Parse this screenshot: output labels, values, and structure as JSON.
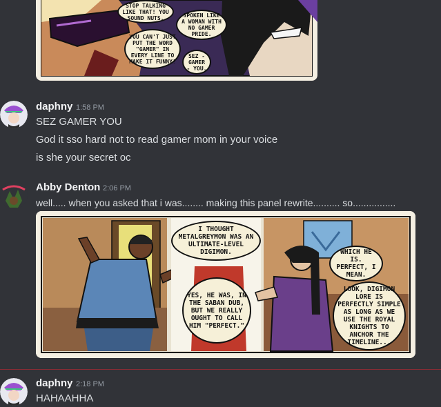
{
  "attachment_top": {
    "bubbles": [
      "STOP TALKING LIKE THAT! YOU SOUND NUTS.",
      "YOU CAN'T JUST PUT THE WORD \"GAMER\" IN EVERY LINE TO MAKE IT FUNNY!",
      "SPOKEN LIKE A WOMAN WITH NO GAMER PRIDE.",
      "SEZ - GAMER - YOU."
    ]
  },
  "messages": [
    {
      "username": "daphny",
      "timestamp": "1:58 PM",
      "lines": [
        "SEZ GAMER YOU",
        "God it sso hard not to read gamer mom in your voice",
        "is she your secret oc"
      ]
    },
    {
      "username": "Abby Denton",
      "timestamp": "2:06 PM",
      "lines": [
        "well..... when you asked that i was........ making this panel rewrite.......... so................"
      ],
      "attachment": {
        "bubbles": [
          "I THOUGHT METALGREYMON WAS AN ULTIMATE-LEVEL DIGIMON.",
          "YES, HE WAS, IN THE SABAN DUB, BUT WE REALLY OUGHT TO CALL HIM \"PERFECT.\"",
          "WHICH HE IS. PERFECT, I MEAN.",
          "LOOK, DIGIMON LORE IS PERFECTLY SIMPLE AS LONG AS WE USE THE ROYAL KNIGHTS TO ANCHOR THE TIMELINE..."
        ]
      }
    },
    {
      "username": "daphny",
      "timestamp": "2:18 PM",
      "lines": [
        "HAHAAHHA"
      ]
    }
  ],
  "colors": {
    "background": "#313338",
    "username": "#f2f3f5",
    "text": "#dbdee1",
    "timestamp": "#949ba4",
    "new_divider": "#8a2c35"
  }
}
